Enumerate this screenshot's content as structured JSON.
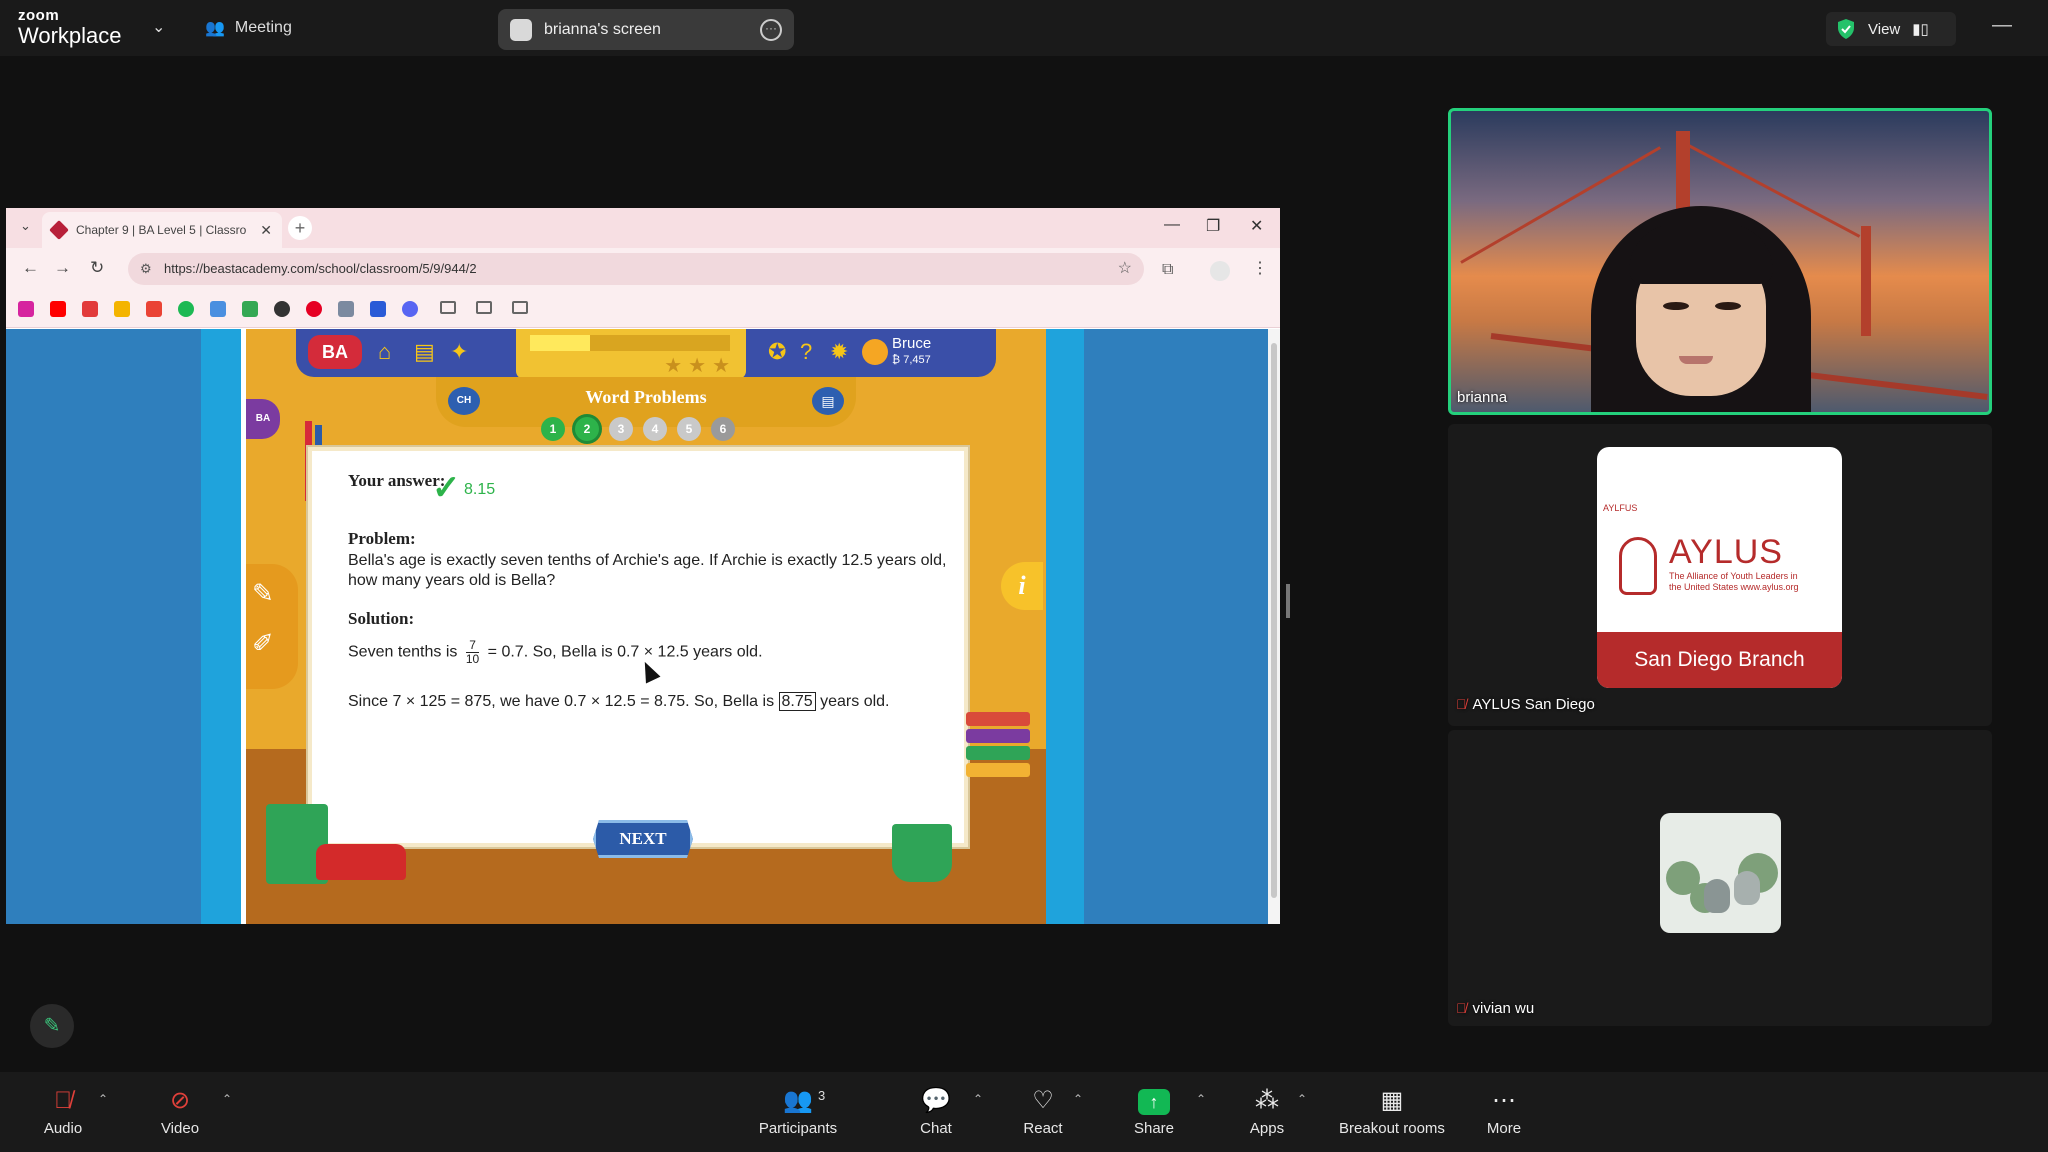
{
  "topbar": {
    "logo_line1": "zoom",
    "logo_line2": "Workplace",
    "meeting_label": "Meeting",
    "shared_screen_label": "brianna's screen",
    "view_label": "View"
  },
  "browser": {
    "tab_title": "Chapter 9 | BA Level 5 | Classro",
    "url": "https://beastacademy.com/school/classroom/5/9/944/2"
  },
  "game": {
    "logo": "BA",
    "section_title": "Word Problems",
    "chapter_badge": "CH",
    "side_badge": "BA",
    "user_name": "Bruce",
    "user_coins": "₿ 7,457",
    "problem_dots": [
      "1",
      "2",
      "3",
      "4",
      "5",
      "6"
    ],
    "answer_label": "Your answer:",
    "answer_value": "8.15",
    "problem_label": "Problem:",
    "problem_text": "Bella's age is exactly seven tenths of Archie's age. If Archie is exactly 12.5 years old, how many years old is Bella?",
    "solution_label": "Solution:",
    "solution_line1_pre": "Seven tenths is",
    "frac_num": "7",
    "frac_den": "10",
    "solution_line1_post": "= 0.7. So, Bella is 0.7 × 12.5 years old.",
    "solution_line2_pre": "Since 7 × 125 = 875, we have 0.7 × 12.5 = 8.75. So, Bella is",
    "solution_boxed": "8.75",
    "solution_line2_post": "years old.",
    "next_button": "NEXT",
    "info_button": "i"
  },
  "participants": {
    "video_name": "brianna",
    "tile2_name": "AYLUS San Diego",
    "tile3_name": "vivian wu",
    "aylus_small": "AYLFUS",
    "aylus_big": "AYLUS",
    "aylus_sub": "The Alliance of Youth Leaders in the United States www.aylus.org",
    "aylus_banner": "San Diego Branch"
  },
  "toolbar": {
    "audio": "Audio",
    "video": "Video",
    "participants": "Participants",
    "participants_count": "3",
    "chat": "Chat",
    "react": "React",
    "share": "Share",
    "apps": "Apps",
    "breakout": "Breakout rooms",
    "more": "More"
  },
  "colors": {
    "accent_green": "#24d07c",
    "share_green": "#12b854",
    "muted_red": "#e0403a"
  }
}
